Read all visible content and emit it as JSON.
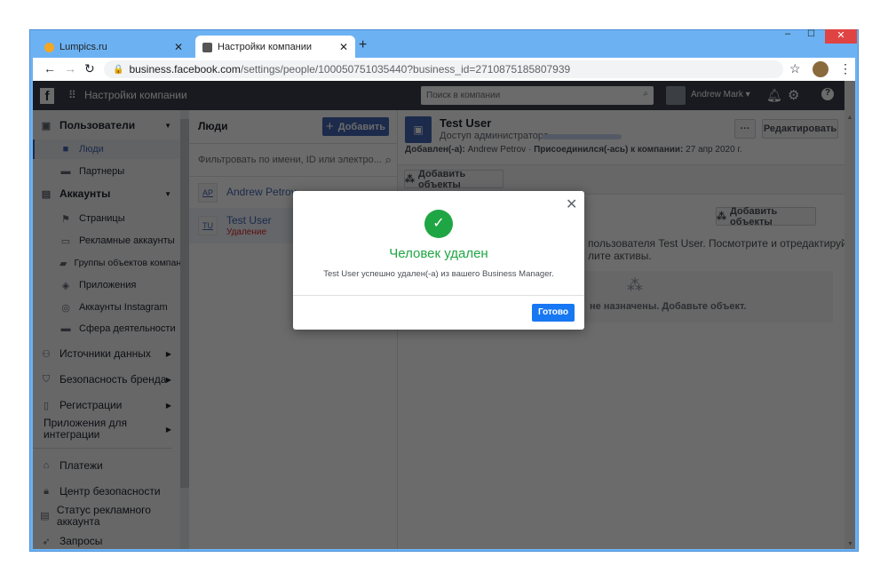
{
  "browser": {
    "tabs": [
      {
        "label": "Lumpics.ru",
        "active": false
      },
      {
        "label": "Настройки компании",
        "active": true
      }
    ],
    "url_host": "business.facebook.com",
    "url_path": "/settings/people/100050751035440?business_id=2710875185807939"
  },
  "header": {
    "title": "Настройки компании",
    "search_placeholder": "Поиск в компании",
    "user": "Andrew Mark"
  },
  "sidebar": {
    "sections": [
      {
        "label": "Пользователи",
        "icon": "users-icon",
        "items": [
          {
            "label": "Люди",
            "icon": "person-icon",
            "selected": true
          },
          {
            "label": "Партнеры",
            "icon": "briefcase-icon"
          }
        ]
      },
      {
        "label": "Аккаунты",
        "icon": "archive-icon",
        "items": [
          {
            "label": "Страницы",
            "icon": "flag-icon"
          },
          {
            "label": "Рекламные аккаунты",
            "icon": "ad-account-icon"
          },
          {
            "label": "Группы объектов компании",
            "icon": "folder-icon"
          },
          {
            "label": "Приложения",
            "icon": "cube-icon"
          },
          {
            "label": "Аккаунты Instagram",
            "icon": "instagram-icon"
          },
          {
            "label": "Сфера деятельности",
            "icon": "briefcase-icon"
          }
        ]
      }
    ],
    "groups": [
      {
        "label": "Источники данных",
        "icon": "data-sources-icon"
      },
      {
        "label": "Безопасность бренда",
        "icon": "shield-icon"
      },
      {
        "label": "Регистрации",
        "icon": "clipboard-icon"
      },
      {
        "label": "Приложения для интеграции",
        "icon": "integration-icon"
      }
    ],
    "links": [
      {
        "label": "Платежи",
        "icon": "bank-icon"
      },
      {
        "label": "Центр безопасности",
        "icon": "lock-icon"
      },
      {
        "label": "Статус рекламного аккаунта",
        "icon": "ad-status-icon"
      },
      {
        "label": "Запросы",
        "icon": "rocket-icon"
      }
    ]
  },
  "people": {
    "title": "Люди",
    "add_label": "Добавить",
    "filter_placeholder": "Фильтровать по имени, ID или электро...",
    "list": [
      {
        "initials": "AP",
        "name": "Andrew Petrov",
        "status": ""
      },
      {
        "initials": "TU",
        "name": "Test User",
        "status": "Удаление"
      }
    ]
  },
  "detail": {
    "name": "Test User",
    "role": "Доступ администратора",
    "added_by_label": "Добавлен(-а):",
    "added_by": "Andrew Petrov",
    "joined_label": "Присоединился(-ась) к компании:",
    "joined": "27 апр 2020 г.",
    "more_label": "···",
    "edit_label": "Редактировать",
    "add_objects_label": "Добавить объекты",
    "add_objects_label2": "Добавить объекты",
    "desc_line1": "пользователя Test User. Посмотрите и отредактируйте",
    "desc_line2": "лите активы.",
    "empty_text": "не назначены. Добавьте объект."
  },
  "dialog": {
    "title": "Человек удален",
    "message": "Test User успешно удален(-а) из вашего Business Manager.",
    "done_label": "Готово",
    "accent": "#1877f2",
    "success": "#1fa644"
  }
}
